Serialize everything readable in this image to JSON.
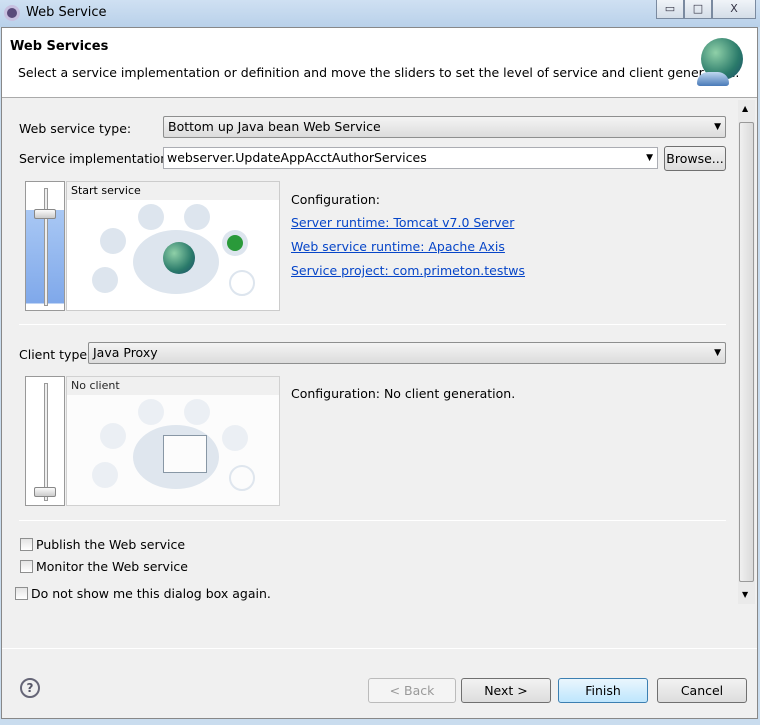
{
  "window": {
    "title": "Web Service",
    "min": "▭",
    "max": "□",
    "close": "X"
  },
  "header": {
    "title": "Web Services",
    "description": "Select a service implementation or definition and move the sliders to set the level of service and client generation."
  },
  "service": {
    "type_label": "Web service type:",
    "type_value": "Bottom up Java bean Web Service",
    "impl_label": "Service implementation:",
    "impl_value": "webserver.UpdateAppAcctAuthorServices",
    "browse": "Browse...",
    "panel_caption": "Start service",
    "slider_level": "Start service",
    "config_label": "Configuration:",
    "links": [
      "Server runtime: Tomcat v7.0 Server",
      "Web service runtime: Apache Axis",
      "Service project: com.primeton.testws"
    ]
  },
  "client": {
    "type_label": "Client type:",
    "type_value": "Java Proxy",
    "panel_caption": "No client",
    "slider_level": "No client",
    "config": "Configuration: No client generation."
  },
  "options": {
    "publish": "Publish the Web service",
    "monitor": "Monitor the Web service",
    "dont_show": "Do not show me this dialog box again.",
    "publish_checked": false,
    "monitor_checked": false,
    "dont_show_checked": false
  },
  "footer": {
    "help": "?",
    "back": "< Back",
    "next": "Next >",
    "finish": "Finish",
    "cancel": "Cancel"
  }
}
